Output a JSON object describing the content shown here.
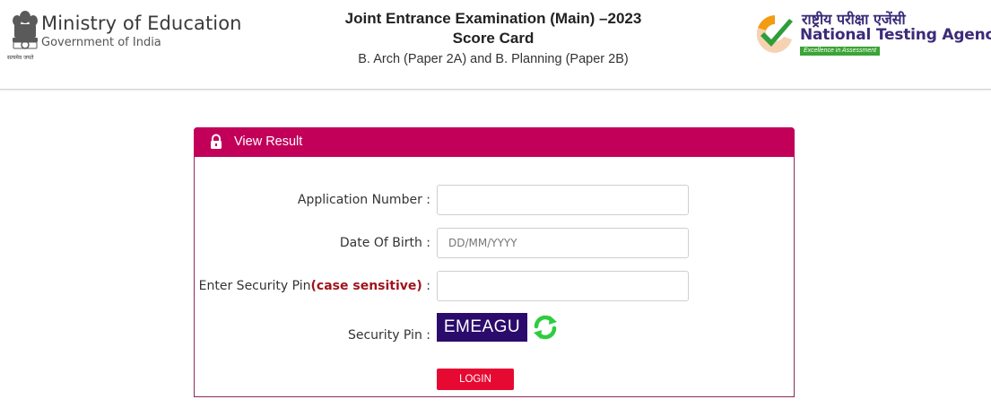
{
  "header": {
    "ministry": {
      "title": "Ministry of Education",
      "subtitle": "Government of India",
      "emblem_caption": "सत्यमेव जयते"
    },
    "exam": {
      "title": "Joint Entrance Examination (Main) –2023",
      "subtitle": "Score Card",
      "paper": "B. Arch (Paper 2A) and B. Planning (Paper 2B)"
    },
    "agency": {
      "hindi_name": "राष्ट्रीय परीक्षा एजेंसी",
      "name": "National Testing Agency",
      "tagline": "Excellence in Assessment"
    }
  },
  "panel": {
    "title": "View Result",
    "application_label": "Application Number :",
    "application_value": "",
    "dob_label": "Date Of Birth :",
    "dob_placeholder": "DD/MM/YYYY",
    "pin_label": "Enter Security Pin",
    "pin_label_highlight": "(case sensitive)",
    "pin_label_suffix": " :",
    "pin_value": "",
    "security_pin_label": "Security Pin :",
    "captcha_text": "EMEAGU",
    "login_label": "LOGIN"
  },
  "icons": {
    "panel": "lock-icon",
    "captcha_refresh": "refresh-icon",
    "ministry": "state-emblem-icon",
    "agency": "nta-checkmark-logo-icon"
  },
  "colors": {
    "panel_header": "#c2005a",
    "panel_border": "#8a2a5a",
    "login_button": "#e60a33",
    "captcha_bg": "#2b0b6b",
    "highlight_text": "#a0141e",
    "agency_text": "#3b2b7a",
    "refresh_green": "#2ecc40"
  }
}
